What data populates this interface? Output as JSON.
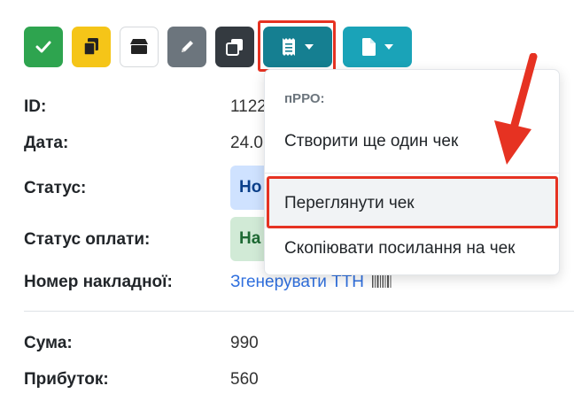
{
  "colors": {
    "success": "#2ea44f",
    "warning": "#f5c518",
    "secondary": "#6c757d",
    "dark": "#343a40",
    "teal_dark": "#157f91",
    "teal": "#1aa3b8",
    "highlight": "#e63222",
    "link": "#2f6fde"
  },
  "toolbar": {
    "buttons": [
      {
        "name": "check-button",
        "icon": "check-icon"
      },
      {
        "name": "copy-button",
        "icon": "copy-icon"
      },
      {
        "name": "box-button",
        "icon": "box-icon"
      },
      {
        "name": "edit-button",
        "icon": "pencil-icon"
      },
      {
        "name": "duplicate-button",
        "icon": "duplicate-icon"
      },
      {
        "name": "receipt-dropdown-button",
        "icon": "receipt-icon"
      },
      {
        "name": "document-dropdown-button",
        "icon": "document-icon"
      }
    ]
  },
  "details": {
    "id": {
      "label": "ID:",
      "value": "1122"
    },
    "date": {
      "label": "Дата:",
      "value": "24.0"
    },
    "status": {
      "label": "Статус:",
      "value": "Но"
    },
    "payment_status": {
      "label": "Статус оплати:",
      "value": "На"
    },
    "invoice": {
      "label": "Номер накладної:",
      "value": "Згенерувати ТТН"
    },
    "sum": {
      "label": "Сума:",
      "value": "990"
    },
    "profit": {
      "label": "Прибуток:",
      "value": "560"
    }
  },
  "menu": {
    "header": "пРРО:",
    "items": [
      {
        "label": "Створити ще один чек"
      },
      {
        "label": "Переглянути чек"
      },
      {
        "label": "Скопіювати посилання на чек"
      }
    ]
  }
}
